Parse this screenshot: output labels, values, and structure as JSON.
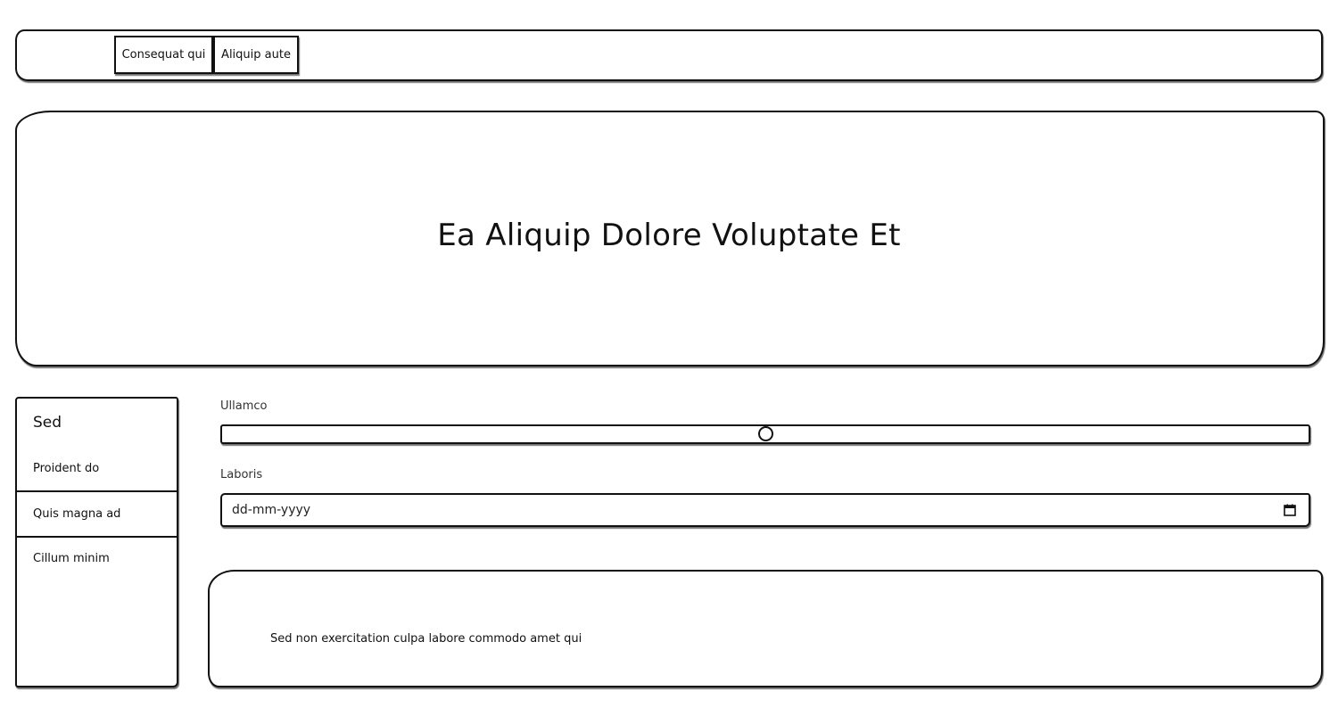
{
  "navbar": {
    "buttons": [
      {
        "label": "Consequat qui"
      },
      {
        "label": "Aliquip aute"
      }
    ]
  },
  "hero": {
    "title": "Ea Aliquip Dolore Voluptate Et"
  },
  "sidebar": {
    "heading": "Sed",
    "items": [
      {
        "label": "Proident do"
      },
      {
        "label": "Quis magna ad"
      },
      {
        "label": "Cillum minim"
      }
    ]
  },
  "form": {
    "slider": {
      "label": "Ullamco",
      "value_fraction": 0.5
    },
    "date": {
      "label": "Laboris",
      "placeholder": "dd-mm-yyyy",
      "icon": "calendar-icon"
    }
  },
  "content": {
    "text": "Sed non exercitation culpa labore commodo amet qui"
  },
  "colors": {
    "border": "#111111",
    "background": "#ffffff"
  }
}
